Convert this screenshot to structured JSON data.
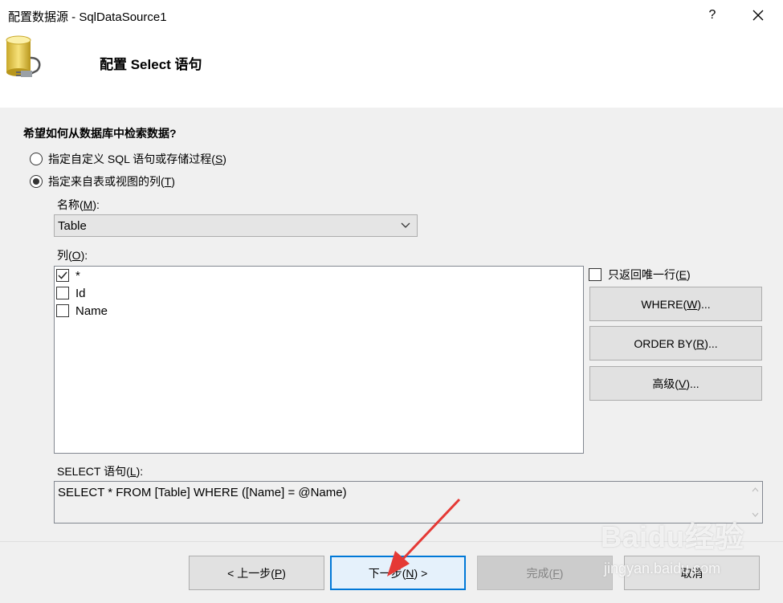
{
  "window": {
    "title": "配置数据源 - SqlDataSource1",
    "help_label": "?",
    "close_icon": "close-icon"
  },
  "header": {
    "title": "配置 Select 语句",
    "icon": "database-plug-icon"
  },
  "question": "希望如何从数据库中检索数据?",
  "options": [
    {
      "label_pre": "指定自定义 SQL 语句或存储过程(",
      "hotkey": "S",
      "label_post": ")",
      "checked": false
    },
    {
      "label_pre": "指定来自表或视图的列(",
      "hotkey": "T",
      "label_post": ")",
      "checked": true
    }
  ],
  "name_field": {
    "label_pre": "名称(",
    "hotkey": "M",
    "label_post": "):",
    "value": "Table"
  },
  "columns": {
    "label_pre": "列(",
    "hotkey": "O",
    "label_post": "):",
    "items": [
      {
        "label": "*",
        "checked": true
      },
      {
        "label": "Id",
        "checked": false
      },
      {
        "label": "Name",
        "checked": false
      }
    ]
  },
  "unique_rows": {
    "label_pre": "只返回唯一行(",
    "hotkey": "E",
    "label_post": ")",
    "checked": false
  },
  "side_buttons": {
    "where": {
      "pre": "WHERE(",
      "hotkey": "W",
      "post": ")..."
    },
    "order_by": {
      "pre": "ORDER BY(",
      "hotkey": "R",
      "post": ")..."
    },
    "advanced": {
      "pre": "高级(",
      "hotkey": "V",
      "post": ")..."
    }
  },
  "sql": {
    "label_pre": "SELECT 语句(",
    "hotkey": "L",
    "label_post": "):",
    "value": "SELECT * FROM [Table] WHERE ([Name] = @Name)"
  },
  "footer": {
    "prev": {
      "pre": "< 上一步(",
      "hotkey": "P",
      "post": ")"
    },
    "next": {
      "pre": "下一步(",
      "hotkey": "N",
      "post": ") >"
    },
    "finish": {
      "pre": "完成(",
      "hotkey": "F",
      "post": ")"
    },
    "cancel": {
      "label": "取消"
    }
  },
  "watermark": {
    "logo": "Baidu经验",
    "url": "jingyan.baidu.com"
  },
  "colors": {
    "accent": "#0078d7",
    "annotation_arrow": "#e53935"
  }
}
